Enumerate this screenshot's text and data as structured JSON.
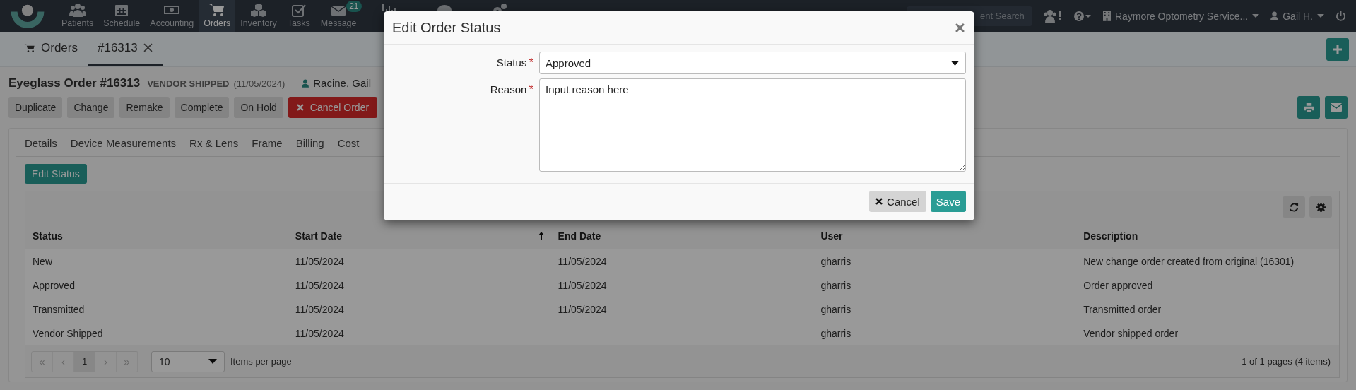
{
  "nav": {
    "items": [
      {
        "kind": "users",
        "label": "Patients",
        "selected": false
      },
      {
        "kind": "calendar",
        "label": "Schedule",
        "selected": false
      },
      {
        "kind": "money",
        "label": "Accounting",
        "selected": false
      },
      {
        "kind": "cart",
        "label": "Orders",
        "selected": true
      },
      {
        "kind": "cubes",
        "label": "Inventory",
        "selected": false
      },
      {
        "kind": "check",
        "label": "Tasks",
        "selected": false
      },
      {
        "kind": "envelope",
        "label": "Message",
        "selected": false,
        "badge": "21"
      },
      {
        "kind": "chart",
        "selected": false
      },
      {
        "kind": "chat",
        "selected": false
      },
      {
        "kind": "gears",
        "selected": false
      }
    ],
    "search": {
      "placeholder": "ent Search"
    },
    "location": "Raymore Optometry Service...",
    "user": "Gail H."
  },
  "tabs": [
    {
      "label": "Orders",
      "selected": false,
      "closable": false
    },
    {
      "label": "#16313",
      "selected": true,
      "closable": true
    }
  ],
  "order": {
    "title": "Eyeglass Order #16313",
    "status": "VENDOR SHIPPED",
    "status_date": "(11/05/2024)",
    "patient": "Racine, Gail"
  },
  "actions": [
    {
      "label": "Duplicate",
      "kind": "default"
    },
    {
      "label": "Change",
      "kind": "default"
    },
    {
      "label": "Remake",
      "kind": "default"
    },
    {
      "label": "Complete",
      "kind": "default"
    },
    {
      "label": "On Hold",
      "kind": "default"
    },
    {
      "label": "Cancel Order",
      "kind": "danger"
    }
  ],
  "section_tabs": [
    "Details",
    "Device Measurements",
    "Rx & Lens",
    "Frame",
    "Billing",
    "Cost"
  ],
  "edit_status_button": "Edit Status",
  "table": {
    "columns": [
      {
        "label": "Status",
        "sorted": false
      },
      {
        "label": "Start Date",
        "sorted": true
      },
      {
        "label": "End Date",
        "sorted": false
      },
      {
        "label": "User",
        "sorted": false
      },
      {
        "label": "Description",
        "sorted": false
      }
    ],
    "rows": [
      [
        "New",
        "11/05/2024",
        "11/05/2024",
        "gharris",
        "New change order created from original (16301)"
      ],
      [
        "Approved",
        "11/05/2024",
        "11/05/2024",
        "gharris",
        "Order approved"
      ],
      [
        "Transmitted",
        "11/05/2024",
        "11/05/2024",
        "gharris",
        "Transmitted order"
      ],
      [
        "Vendor Shipped",
        "11/05/2024",
        "",
        "gharris",
        "Vendor shipped order"
      ]
    ]
  },
  "pager": {
    "buttons": [
      {
        "label": "«",
        "selected": false
      },
      {
        "label": "‹",
        "selected": false
      },
      {
        "label": "1",
        "selected": true
      },
      {
        "label": "›",
        "selected": false
      },
      {
        "label": "»",
        "selected": false
      }
    ],
    "page_size": "10",
    "page_size_label": "Items per page",
    "summary": "1 of 1 pages (4 items)"
  },
  "modal": {
    "title": "Edit Order Status",
    "status_label": "Status",
    "status_value": "Approved",
    "reason_label": "Reason",
    "reason_value": "Input reason here",
    "required_mark": "*",
    "cancel": "Cancel",
    "save": "Save"
  }
}
